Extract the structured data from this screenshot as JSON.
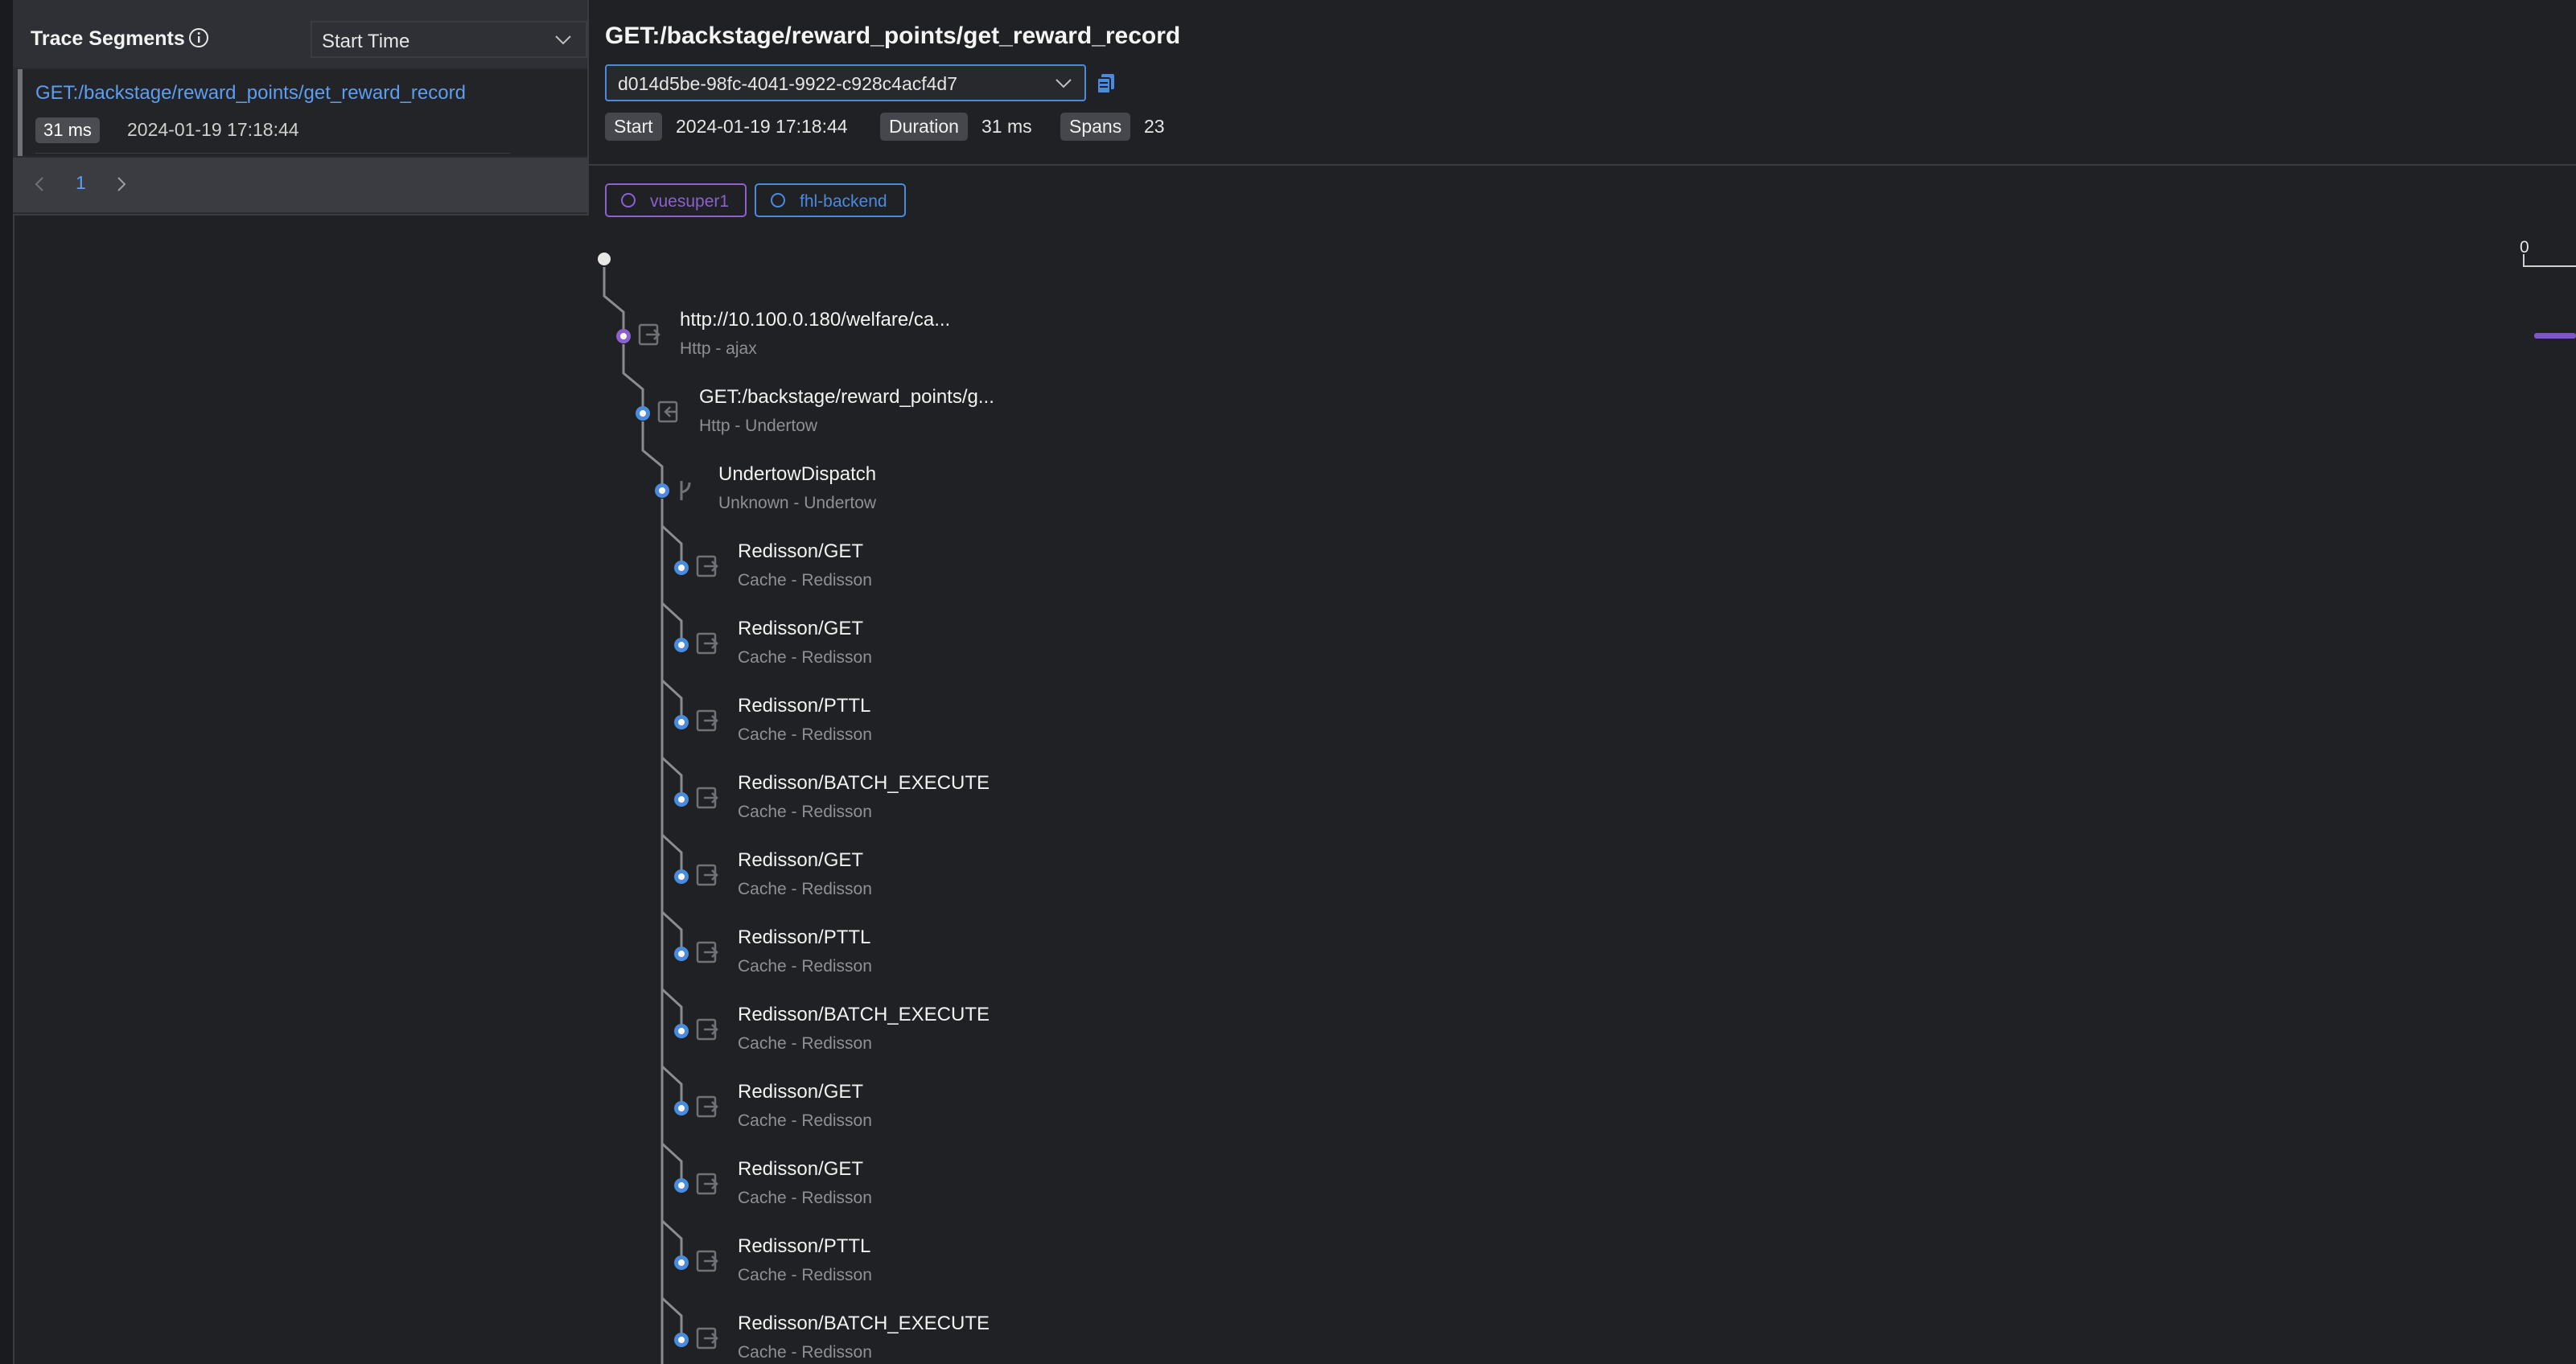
{
  "segments_panel": {
    "title": "Trace Segments",
    "sort_select": "Start Time",
    "items": [
      {
        "name": "GET:/backstage/reward_points/get_reward_record",
        "duration": "31 ms",
        "start": "2024-01-19 17:18:44"
      }
    ],
    "page": "1"
  },
  "trace": {
    "title": "GET:/backstage/reward_points/get_reward_record",
    "trace_id": "d014d5be-98fc-4041-9922-c928c4acf4d7",
    "start_label": "Start",
    "start_value": "2024-01-19 17:18:44",
    "duration_label": "Duration",
    "duration_value": "31 ms",
    "spans_label": "Spans",
    "spans_value": "23"
  },
  "services": [
    {
      "name": "vuesuper1",
      "color": "#8e5fd1"
    },
    {
      "name": "fhl-backend",
      "color": "#4a8be0"
    }
  ],
  "timeline": {
    "axis_start": "0"
  },
  "spans": [
    {
      "name": "http://10.100.0.180/welfare/ca...",
      "sub": "Http - ajax",
      "depth": 1,
      "service": 0,
      "icon": "exit-icon"
    },
    {
      "name": "GET:/backstage/reward_points/g...",
      "sub": "Http - Undertow",
      "depth": 2,
      "service": 1,
      "icon": "entry-icon"
    },
    {
      "name": "UndertowDispatch",
      "sub": "Unknown - Undertow",
      "depth": 3,
      "service": 1,
      "icon": "branch-icon"
    },
    {
      "name": "Redisson/GET",
      "sub": "Cache - Redisson",
      "depth": 4,
      "service": 1,
      "icon": "exit-icon"
    },
    {
      "name": "Redisson/GET",
      "sub": "Cache - Redisson",
      "depth": 4,
      "service": 1,
      "icon": "exit-icon"
    },
    {
      "name": "Redisson/PTTL",
      "sub": "Cache - Redisson",
      "depth": 4,
      "service": 1,
      "icon": "exit-icon"
    },
    {
      "name": "Redisson/BATCH_EXECUTE",
      "sub": "Cache - Redisson",
      "depth": 4,
      "service": 1,
      "icon": "exit-icon"
    },
    {
      "name": "Redisson/GET",
      "sub": "Cache - Redisson",
      "depth": 4,
      "service": 1,
      "icon": "exit-icon"
    },
    {
      "name": "Redisson/PTTL",
      "sub": "Cache - Redisson",
      "depth": 4,
      "service": 1,
      "icon": "exit-icon"
    },
    {
      "name": "Redisson/BATCH_EXECUTE",
      "sub": "Cache - Redisson",
      "depth": 4,
      "service": 1,
      "icon": "exit-icon"
    },
    {
      "name": "Redisson/GET",
      "sub": "Cache - Redisson",
      "depth": 4,
      "service": 1,
      "icon": "exit-icon"
    },
    {
      "name": "Redisson/GET",
      "sub": "Cache - Redisson",
      "depth": 4,
      "service": 1,
      "icon": "exit-icon"
    },
    {
      "name": "Redisson/PTTL",
      "sub": "Cache - Redisson",
      "depth": 4,
      "service": 1,
      "icon": "exit-icon"
    },
    {
      "name": "Redisson/BATCH_EXECUTE",
      "sub": "Cache - Redisson",
      "depth": 4,
      "service": 1,
      "icon": "exit-icon"
    }
  ]
}
